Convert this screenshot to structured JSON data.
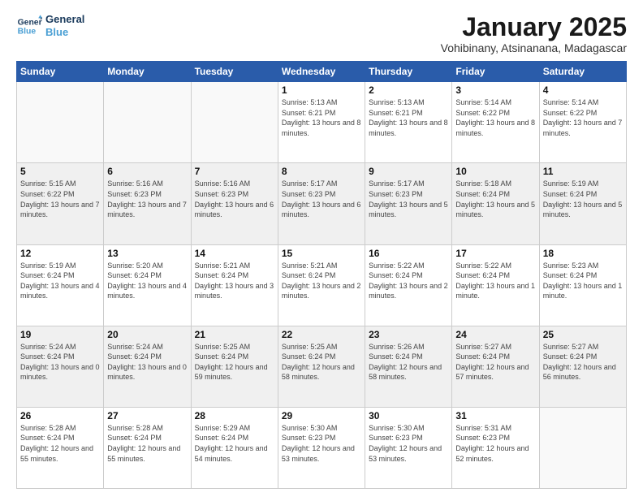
{
  "logo": {
    "line1": "General",
    "line2": "Blue"
  },
  "title": "January 2025",
  "location": "Vohibinany, Atsinanana, Madagascar",
  "weekdays": [
    "Sunday",
    "Monday",
    "Tuesday",
    "Wednesday",
    "Thursday",
    "Friday",
    "Saturday"
  ],
  "weeks": [
    [
      {
        "day": "",
        "info": ""
      },
      {
        "day": "",
        "info": ""
      },
      {
        "day": "",
        "info": ""
      },
      {
        "day": "1",
        "info": "Sunrise: 5:13 AM\nSunset: 6:21 PM\nDaylight: 13 hours and 8 minutes."
      },
      {
        "day": "2",
        "info": "Sunrise: 5:13 AM\nSunset: 6:21 PM\nDaylight: 13 hours and 8 minutes."
      },
      {
        "day": "3",
        "info": "Sunrise: 5:14 AM\nSunset: 6:22 PM\nDaylight: 13 hours and 8 minutes."
      },
      {
        "day": "4",
        "info": "Sunrise: 5:14 AM\nSunset: 6:22 PM\nDaylight: 13 hours and 7 minutes."
      }
    ],
    [
      {
        "day": "5",
        "info": "Sunrise: 5:15 AM\nSunset: 6:22 PM\nDaylight: 13 hours and 7 minutes."
      },
      {
        "day": "6",
        "info": "Sunrise: 5:16 AM\nSunset: 6:23 PM\nDaylight: 13 hours and 7 minutes."
      },
      {
        "day": "7",
        "info": "Sunrise: 5:16 AM\nSunset: 6:23 PM\nDaylight: 13 hours and 6 minutes."
      },
      {
        "day": "8",
        "info": "Sunrise: 5:17 AM\nSunset: 6:23 PM\nDaylight: 13 hours and 6 minutes."
      },
      {
        "day": "9",
        "info": "Sunrise: 5:17 AM\nSunset: 6:23 PM\nDaylight: 13 hours and 5 minutes."
      },
      {
        "day": "10",
        "info": "Sunrise: 5:18 AM\nSunset: 6:24 PM\nDaylight: 13 hours and 5 minutes."
      },
      {
        "day": "11",
        "info": "Sunrise: 5:19 AM\nSunset: 6:24 PM\nDaylight: 13 hours and 5 minutes."
      }
    ],
    [
      {
        "day": "12",
        "info": "Sunrise: 5:19 AM\nSunset: 6:24 PM\nDaylight: 13 hours and 4 minutes."
      },
      {
        "day": "13",
        "info": "Sunrise: 5:20 AM\nSunset: 6:24 PM\nDaylight: 13 hours and 4 minutes."
      },
      {
        "day": "14",
        "info": "Sunrise: 5:21 AM\nSunset: 6:24 PM\nDaylight: 13 hours and 3 minutes."
      },
      {
        "day": "15",
        "info": "Sunrise: 5:21 AM\nSunset: 6:24 PM\nDaylight: 13 hours and 2 minutes."
      },
      {
        "day": "16",
        "info": "Sunrise: 5:22 AM\nSunset: 6:24 PM\nDaylight: 13 hours and 2 minutes."
      },
      {
        "day": "17",
        "info": "Sunrise: 5:22 AM\nSunset: 6:24 PM\nDaylight: 13 hours and 1 minute."
      },
      {
        "day": "18",
        "info": "Sunrise: 5:23 AM\nSunset: 6:24 PM\nDaylight: 13 hours and 1 minute."
      }
    ],
    [
      {
        "day": "19",
        "info": "Sunrise: 5:24 AM\nSunset: 6:24 PM\nDaylight: 13 hours and 0 minutes."
      },
      {
        "day": "20",
        "info": "Sunrise: 5:24 AM\nSunset: 6:24 PM\nDaylight: 13 hours and 0 minutes."
      },
      {
        "day": "21",
        "info": "Sunrise: 5:25 AM\nSunset: 6:24 PM\nDaylight: 12 hours and 59 minutes."
      },
      {
        "day": "22",
        "info": "Sunrise: 5:25 AM\nSunset: 6:24 PM\nDaylight: 12 hours and 58 minutes."
      },
      {
        "day": "23",
        "info": "Sunrise: 5:26 AM\nSunset: 6:24 PM\nDaylight: 12 hours and 58 minutes."
      },
      {
        "day": "24",
        "info": "Sunrise: 5:27 AM\nSunset: 6:24 PM\nDaylight: 12 hours and 57 minutes."
      },
      {
        "day": "25",
        "info": "Sunrise: 5:27 AM\nSunset: 6:24 PM\nDaylight: 12 hours and 56 minutes."
      }
    ],
    [
      {
        "day": "26",
        "info": "Sunrise: 5:28 AM\nSunset: 6:24 PM\nDaylight: 12 hours and 55 minutes."
      },
      {
        "day": "27",
        "info": "Sunrise: 5:28 AM\nSunset: 6:24 PM\nDaylight: 12 hours and 55 minutes."
      },
      {
        "day": "28",
        "info": "Sunrise: 5:29 AM\nSunset: 6:24 PM\nDaylight: 12 hours and 54 minutes."
      },
      {
        "day": "29",
        "info": "Sunrise: 5:30 AM\nSunset: 6:23 PM\nDaylight: 12 hours and 53 minutes."
      },
      {
        "day": "30",
        "info": "Sunrise: 5:30 AM\nSunset: 6:23 PM\nDaylight: 12 hours and 53 minutes."
      },
      {
        "day": "31",
        "info": "Sunrise: 5:31 AM\nSunset: 6:23 PM\nDaylight: 12 hours and 52 minutes."
      },
      {
        "day": "",
        "info": ""
      }
    ]
  ]
}
